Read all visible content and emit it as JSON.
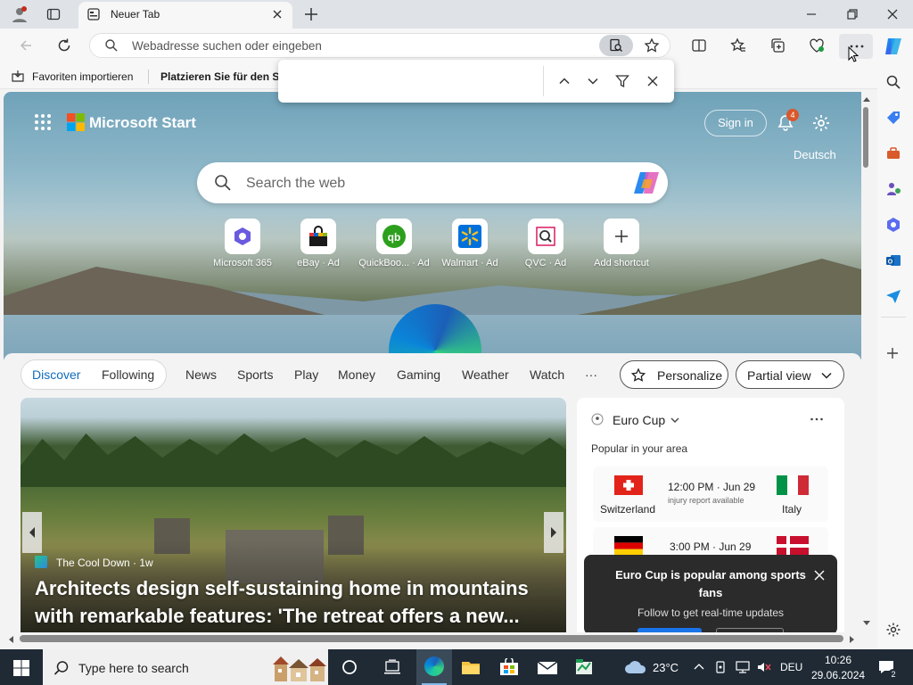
{
  "browser": {
    "tab_title": "Neuer Tab",
    "address_placeholder": "Webadresse suchen oder eingeben",
    "favorites": [
      "Favoriten importieren",
      "Platzieren Sie für den Sc"
    ],
    "find_value": ""
  },
  "start": {
    "brand": "Microsoft Start",
    "sign_in": "Sign in",
    "notifications": "4",
    "language": "Deutsch",
    "search_placeholder": "Search the web",
    "shortcuts": [
      {
        "label": "Microsoft 365"
      },
      {
        "label": "eBay · Ad"
      },
      {
        "label": "QuickBoo... · Ad"
      },
      {
        "label": "Walmart · Ad"
      },
      {
        "label": "QVC · Ad"
      },
      {
        "label": "Add shortcut"
      }
    ]
  },
  "feed": {
    "tabs": [
      "Discover",
      "Following"
    ],
    "nav": [
      "News",
      "Sports",
      "Play",
      "Money",
      "Gaming",
      "Weather",
      "Watch",
      "···"
    ],
    "personalize": "Personalize",
    "view": "Partial view",
    "article": {
      "source": "The Cool Down · 1w",
      "title": "Architects design self-sustaining home in mountains with remarkable features: 'The retreat offers a new..."
    },
    "card": {
      "title": "Euro Cup",
      "subtitle": "Popular in your area",
      "match1": {
        "home": "Switzerland",
        "away": "Italy",
        "time": "12:00 PM · Jun 29",
        "note": "injury report available"
      },
      "match2": {
        "time": "3:00 PM · Jun 29"
      },
      "toast_title": "Euro Cup is popular among sports fans",
      "toast_sub": "Follow to get real-time updates"
    }
  },
  "taskbar": {
    "search_placeholder": "Type here to search",
    "weather": "23°C",
    "lang": "DEU",
    "time": "10:26",
    "date": "29.06.2024",
    "notif_count": "2"
  },
  "colors": {
    "accent": "#0f6cbd",
    "taskbar": "#1f2a35"
  }
}
